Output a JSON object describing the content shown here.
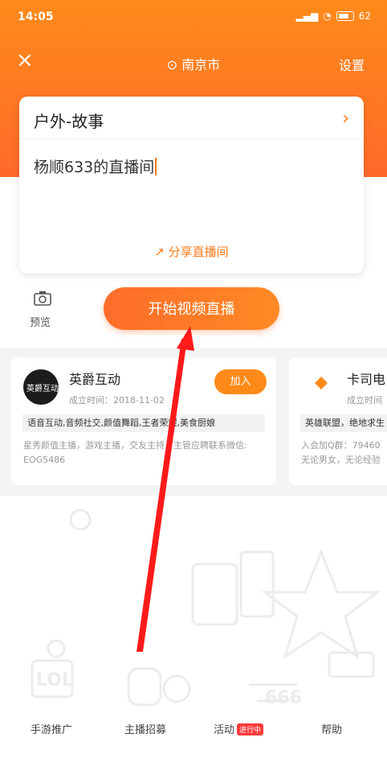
{
  "status_bar": {
    "time": "14:05",
    "right": "62"
  },
  "header": {
    "close": "×",
    "location": "南京市",
    "settings": "设置"
  },
  "card": {
    "category": "户外-故事",
    "title": "杨顺633的直播间",
    "share": "分享直播间"
  },
  "preview_label": "预览",
  "start_button": "开始视频直播",
  "guilds": [
    {
      "logo": "英爵互动",
      "name": "英爵互动",
      "date": "成立时间：2018-11-02",
      "join": "加入",
      "tags": "语音互动,音频社交,颜值舞蹈,王者荣耀,美食厨娘",
      "desc1": "星秀颜值主播，游戏主播，交友主持，主管应聘联系微信:",
      "desc2": "EOG5486"
    },
    {
      "logo": "卡司互娱",
      "name": "卡司电",
      "date": "成立时间",
      "tags": "英雄联盟，绝地求生",
      "desc1": "入会加Q群：79460",
      "desc2": "无论男女，无论经验"
    }
  ],
  "bottom_nav": [
    {
      "label": "手游推广"
    },
    {
      "label": "主播招募"
    },
    {
      "label": "活动",
      "badge": "进行中"
    },
    {
      "label": "帮助"
    }
  ],
  "colors": {
    "accent": "#ff7a1a",
    "arrow": "#ff1a1a"
  }
}
